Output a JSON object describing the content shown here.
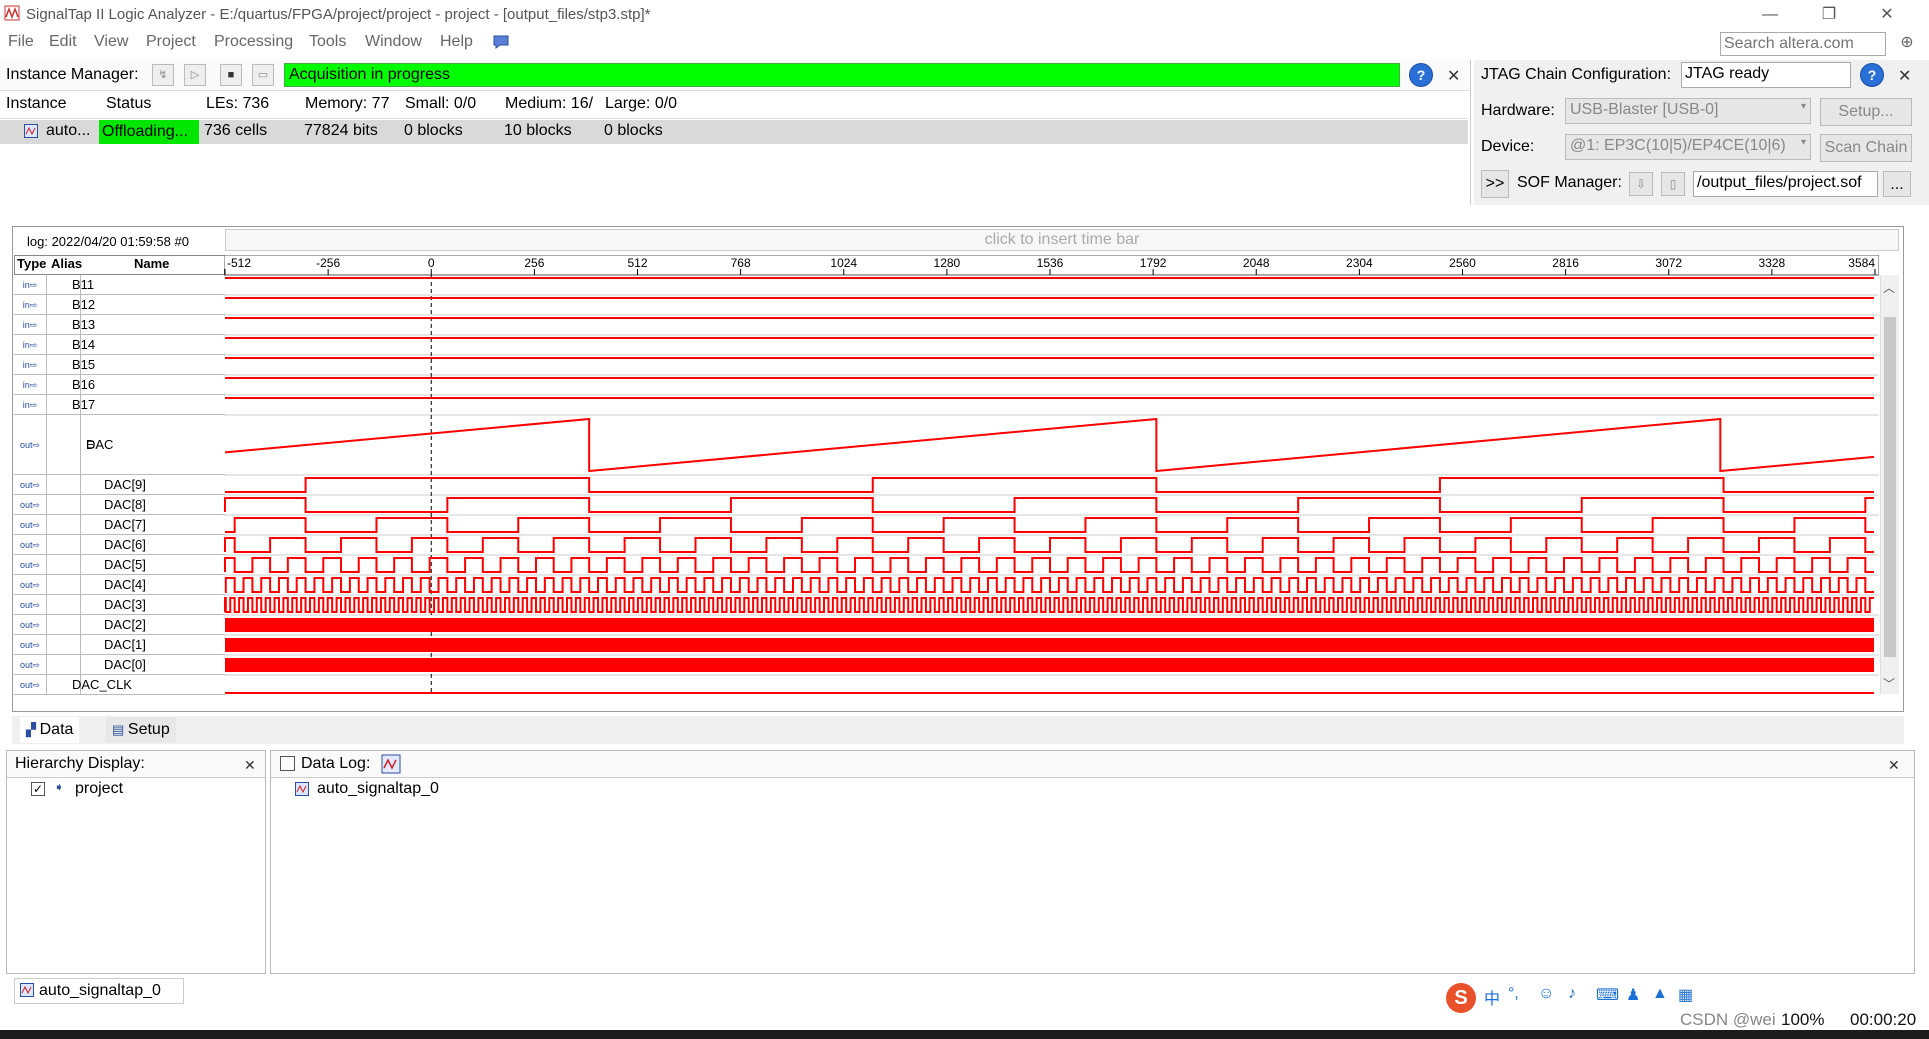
{
  "window": {
    "title": "SignalTap II Logic Analyzer - E:/quartus/FPGA/project/project - project - [output_files/stp3.stp]*",
    "minimize": "—",
    "restore": "❐",
    "close": "✕"
  },
  "menu": {
    "items": [
      "File",
      "Edit",
      "View",
      "Project",
      "Processing",
      "Tools",
      "Window",
      "Help"
    ],
    "search_placeholder": "Search altera.com"
  },
  "instance_manager": {
    "label": "Instance Manager:",
    "acquisition_status": "Acquisition in progress",
    "columns": [
      "Instance",
      "Status",
      "LEs: 736",
      "Memory: 77",
      "Small: 0/0",
      "Medium: 16/",
      "Large: 0/0"
    ],
    "row": {
      "instance": "auto...",
      "status": "Offloading...",
      "les": "736 cells",
      "memory": "77824 bits",
      "small": "0 blocks",
      "medium": "10 blocks",
      "large": "0 blocks"
    }
  },
  "jtag": {
    "label": "JTAG Chain Configuration:",
    "status": "JTAG ready",
    "hardware_label": "Hardware:",
    "hardware_value": "USB-Blaster [USB-0]",
    "setup_button": "Setup...",
    "device_label": "Device:",
    "device_value": "@1: EP3C(10|5)/EP4CE(10|6)",
    "scan_chain_button": "Scan Chain",
    "expand_button": ">>",
    "sof_label": "SOF Manager:",
    "sof_path": "/output_files/project.sof",
    "browse_button": "..."
  },
  "waveform": {
    "log": "log: 2022/04/20 01:59:58  #0",
    "insert_bar": "click to insert time bar",
    "headers": {
      "type": "Type",
      "alias": "Alias",
      "name": "Name"
    },
    "ticks": [
      "-512",
      "-256",
      "0",
      "256",
      "512",
      "768",
      "1024",
      "1280",
      "1536",
      "1792",
      "2048",
      "2304",
      "2560",
      "2816",
      "3072",
      "3328",
      "3584"
    ],
    "signals": [
      {
        "name": "B11",
        "type": "in"
      },
      {
        "name": "B12",
        "type": "in"
      },
      {
        "name": "B13",
        "type": "in"
      },
      {
        "name": "B14",
        "type": "in"
      },
      {
        "name": "B15",
        "type": "in"
      },
      {
        "name": "B16",
        "type": "in"
      },
      {
        "name": "B17",
        "type": "in"
      },
      {
        "name": "DAC",
        "type": "out",
        "bus": true
      },
      {
        "name": "DAC[9]",
        "type": "out"
      },
      {
        "name": "DAC[8]",
        "type": "out"
      },
      {
        "name": "DAC[7]",
        "type": "out"
      },
      {
        "name": "DAC[6]",
        "type": "out"
      },
      {
        "name": "DAC[5]",
        "type": "out"
      },
      {
        "name": "DAC[4]",
        "type": "out"
      },
      {
        "name": "DAC[3]",
        "type": "out"
      },
      {
        "name": "DAC[2]",
        "type": "out"
      },
      {
        "name": "DAC[1]",
        "type": "out"
      },
      {
        "name": "DAC[0]",
        "type": "out"
      },
      {
        "name": "DAC_CLK",
        "type": "out"
      }
    ],
    "trace_color": "#ff0000"
  },
  "tabs": {
    "data": "Data",
    "setup": "Setup"
  },
  "hierarchy": {
    "title": "Hierarchy Display:",
    "item": "project"
  },
  "data_log": {
    "title": "Data Log:",
    "item": "auto_signaltap_0"
  },
  "status_tab": "auto_signaltap_0",
  "watermark": {
    "text": "CSDN @wei",
    "zoom": "100%",
    "time": "00:00:20"
  }
}
